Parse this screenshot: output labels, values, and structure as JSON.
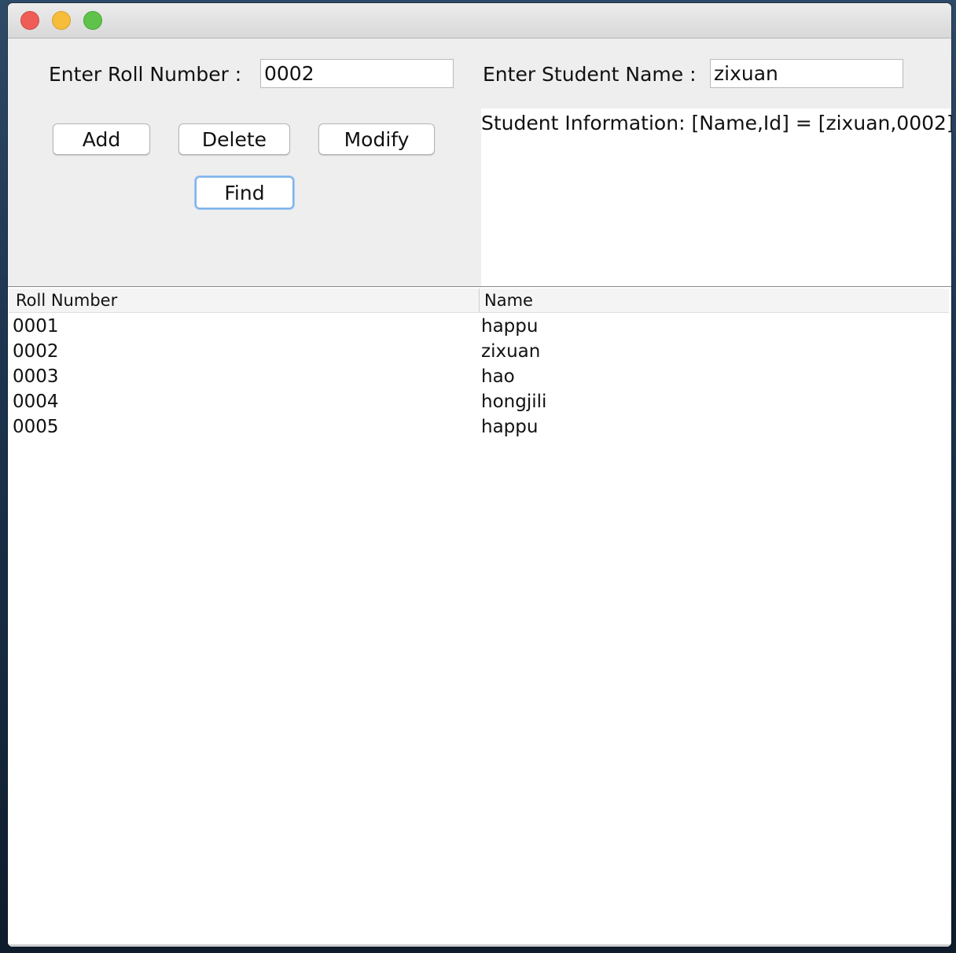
{
  "window": {
    "controls": [
      "close-icon",
      "minimize-icon",
      "zoom-icon"
    ]
  },
  "form": {
    "roll_label": "Enter Roll Number :",
    "roll_value": "0002",
    "name_label": "Enter Student Name :",
    "name_value": "zixuan"
  },
  "buttons": {
    "add": "Add",
    "delete": "Delete",
    "modify": "Modify",
    "find": "Find"
  },
  "info": {
    "text": "Student Information: [Name,Id] = [zixuan,0002]"
  },
  "table": {
    "headers": [
      "Roll Number",
      "Name"
    ],
    "rows": [
      [
        "0001",
        "happu"
      ],
      [
        "0002",
        "zixuan"
      ],
      [
        "0003",
        "hao"
      ],
      [
        "0004",
        "hongjili"
      ],
      [
        "0005",
        "happu"
      ]
    ]
  }
}
